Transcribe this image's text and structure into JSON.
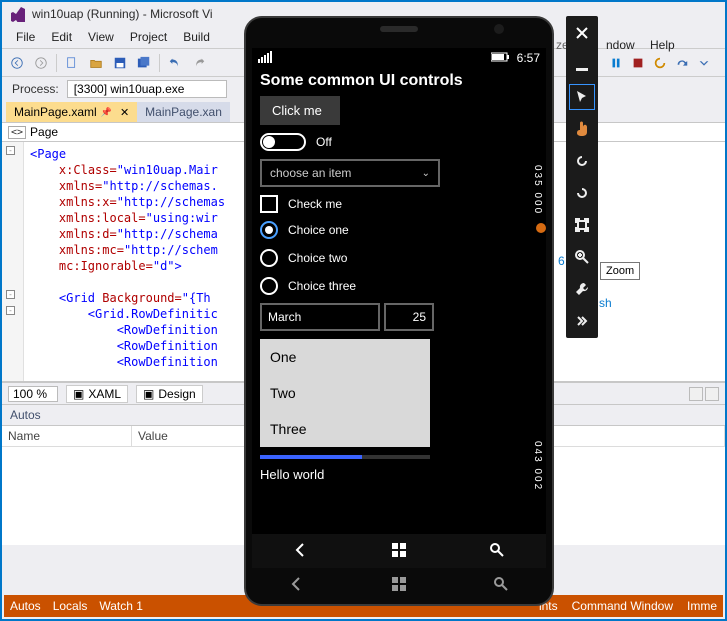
{
  "window": {
    "title": "win10uap (Running) - Microsoft Vi"
  },
  "menu": {
    "file": "File",
    "edit": "Edit",
    "view": "View",
    "project": "Project",
    "build": "Build",
    "help": "Help",
    "ndow": "ndow",
    "ze": "ze"
  },
  "process": {
    "label": "Process:",
    "value": "[3300] win10uap.exe"
  },
  "tabs": {
    "active": "MainPage.xaml",
    "inactive": "MainPage.xan"
  },
  "xaml": {
    "page_node": "Page"
  },
  "code": {
    "l1": "<Page",
    "l2a": "x",
    "l2b": ":Class=",
    "l2c": "\"win10uap.Mair",
    "l3a": "xmlns",
    "l3b": "=",
    "l3c": "\"http://schemas.",
    "l4a": "xmlns",
    "l4b": ":x=",
    "l4c": "\"http://schemas",
    "l5a": "xmlns",
    "l5b": ":local=",
    "l5c": "\"using:wir",
    "l6a": "xmlns",
    "l6b": ":d=",
    "l6c": "\"http://schema",
    "l7a": "xmlns",
    "l7b": ":mc=",
    "l7c": "\"http://schem",
    "l8a": "mc",
    "l8b": ":Ignorable=",
    "l8c": "\"d\"",
    "l8d": ">",
    "l10a": "<Grid ",
    "l10b": "Background",
    "l10c": "=",
    "l10d": "\"{Th",
    "l11": "<Grid.RowDefinitic",
    "l12": "<RowDefinition",
    "l13": "<RowDefinition",
    "l14": "<RowDefinition"
  },
  "zoom": {
    "value": "100 %"
  },
  "modes": {
    "xaml": "XAML",
    "design": "Design"
  },
  "autos": {
    "title": "Autos",
    "col_name": "Name",
    "col_value": "Value"
  },
  "status": {
    "autos": "Autos",
    "locals": "Locals",
    "watch1": "Watch 1",
    "ints": "ints",
    "cmd": "Command Window",
    "imme": "Imme"
  },
  "phone": {
    "clock": "6:57",
    "title": "Some common UI controls",
    "button": "Click me",
    "toggle_label": "Off",
    "combo": "choose an item",
    "check": "Check me",
    "radio1": "Choice one",
    "radio2": "Choice two",
    "radio3": "Choice three",
    "month": "March",
    "day": "25",
    "li1": "One",
    "li2": "Two",
    "li3": "Three",
    "hello": "Hello world",
    "fps_a1": "035",
    "fps_a2": "000",
    "fps_b1": "043",
    "fps_b2": "002"
  },
  "behind": {
    "six": "6",
    "sh": "sh"
  },
  "tooltip": {
    "zoom": "Zoom"
  }
}
